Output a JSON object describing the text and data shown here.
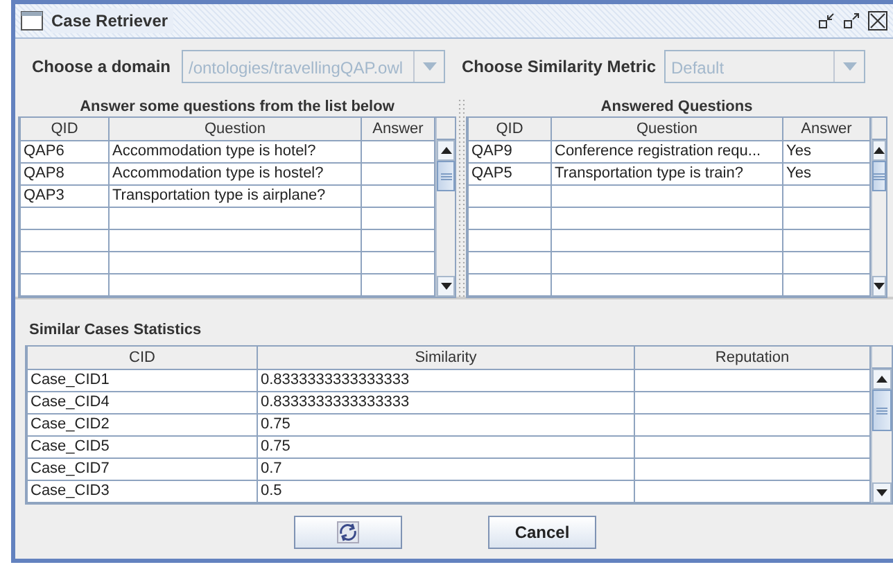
{
  "window": {
    "title": "Case Retriever"
  },
  "domain": {
    "label": "Choose a domain",
    "value": "/ontologies/travellingQAP.owl",
    "disabled": true
  },
  "metric": {
    "label": "Choose Similarity Metric",
    "value": "Default",
    "disabled": true
  },
  "questions": {
    "title": "Answer some questions from the list below",
    "columns": [
      "QID",
      "Question",
      "Answer"
    ],
    "rows": [
      {
        "qid": "QAP6",
        "question": "Accommodation type is hotel?"
      },
      {
        "qid": "QAP8",
        "question": "Accommodation type is hostel?"
      },
      {
        "qid": "QAP3",
        "question": "Transportation type is airplane?"
      }
    ]
  },
  "answered": {
    "title": "Answered Questions",
    "columns": [
      "QID",
      "Question",
      "Answer"
    ],
    "rows": [
      {
        "qid": "QAP9",
        "question": "Conference registration requ...",
        "answer": "Yes"
      },
      {
        "qid": "QAP5",
        "question": "Transportation type is train?",
        "answer": "Yes"
      }
    ]
  },
  "statistics": {
    "title": "Similar Cases Statistics",
    "columns": [
      "CID",
      "Similarity",
      "Reputation"
    ],
    "rows": [
      {
        "cid": "Case_CID1",
        "similarity": "0.8333333333333333"
      },
      {
        "cid": "Case_CID4",
        "similarity": "0.8333333333333333"
      },
      {
        "cid": "Case_CID2",
        "similarity": "0.75"
      },
      {
        "cid": "Case_CID5",
        "similarity": "0.75"
      },
      {
        "cid": "Case_CID7",
        "similarity": "0.7"
      },
      {
        "cid": "Case_CID3",
        "similarity": "0.5"
      }
    ]
  },
  "buttons": [
    {
      "kind": "icon"
    },
    {
      "kind": "text",
      "label": "Cancel"
    }
  ]
}
